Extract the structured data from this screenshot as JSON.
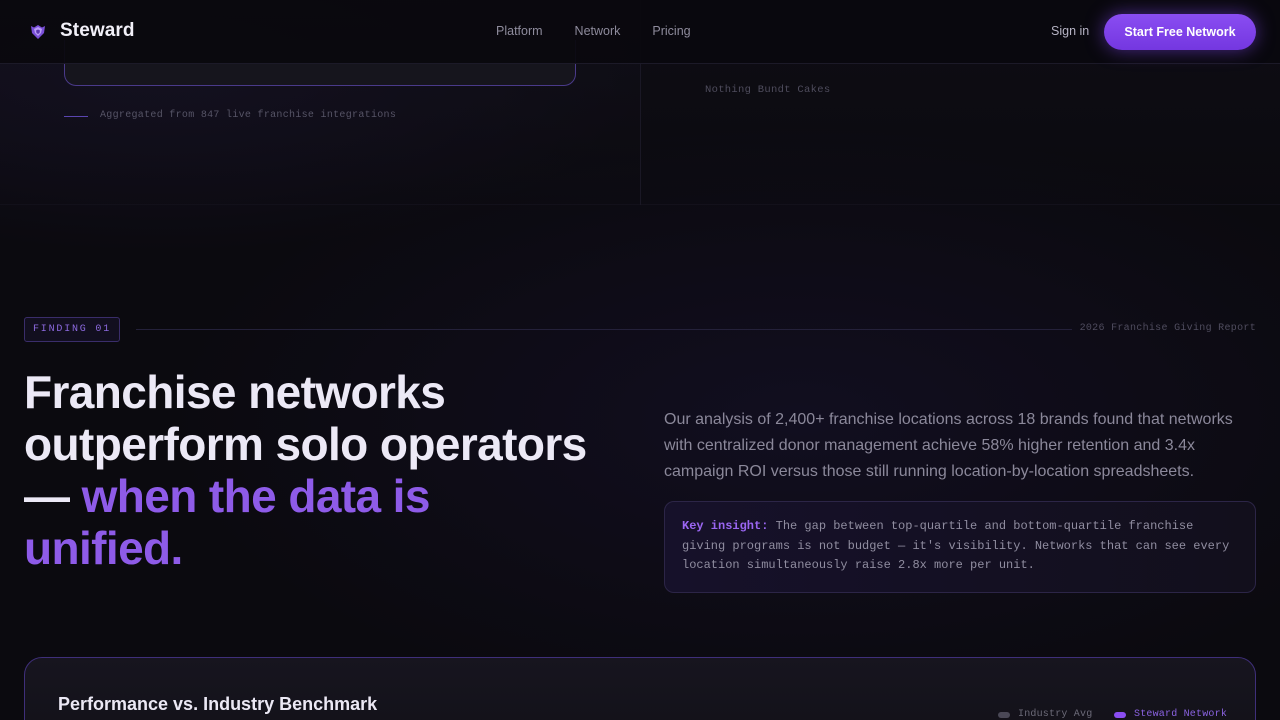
{
  "nav": {
    "brand": "Steward",
    "links": [
      "Platform",
      "Network",
      "Pricing"
    ],
    "sign_in": "Sign in",
    "cta": "Start Free Network"
  },
  "top": {
    "aggregated_note": "Aggregated from 847 live franchise integrations",
    "right_item": "Nothing Bundt Cakes"
  },
  "finding": {
    "badge": "FINDING 01",
    "report": "2026 Franchise Giving Report",
    "headline_line1": "Franchise networks",
    "headline_line2": "outperform solo operators",
    "headline_dash": "— ",
    "headline_accent1": "when the data is",
    "headline_accent2": "unified.",
    "analysis": "Our analysis of 2,400+ franchise locations across 18 brands found that networks with centralized donor management achieve 58% higher retention and 3.4x campaign ROI versus those still running location-by-location spreadsheets.",
    "insight_label": "Key insight:",
    "insight_body": " The gap between top-quartile and bottom-quartile franchise giving programs is not budget — it's visibility. Networks that can see every location simultaneously raise 2.8x more per unit."
  },
  "benchmark": {
    "title": "Performance vs. Industry Benchmark",
    "legend": [
      {
        "label": "Industry Avg",
        "color": "#4a4856"
      },
      {
        "label": "Steward Network",
        "color": "#8a4df2"
      }
    ]
  },
  "colors": {
    "accent": "#8e5be8",
    "cta": "#7c3fe8"
  }
}
